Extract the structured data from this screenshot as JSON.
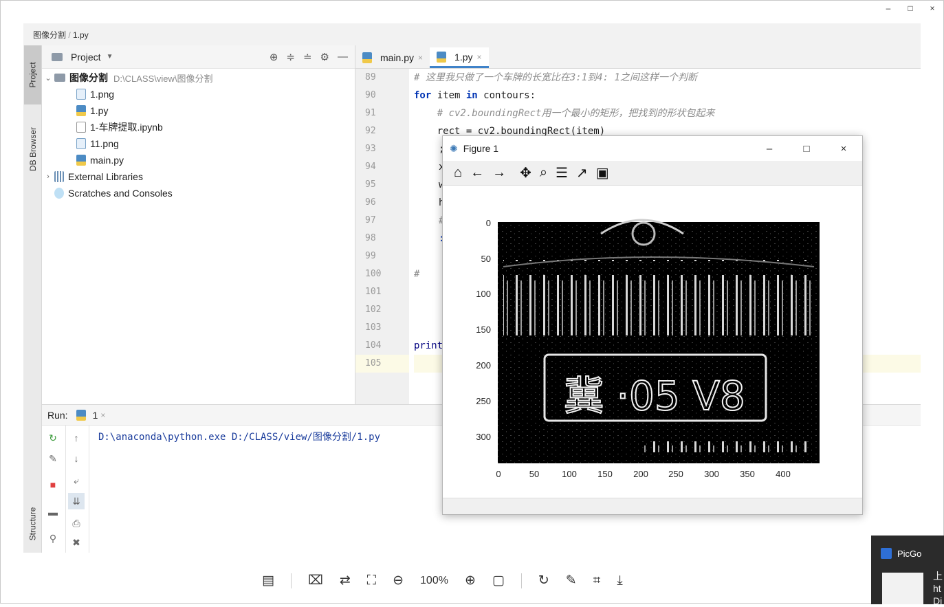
{
  "viewer": {
    "minimize": "–",
    "maximize": "□",
    "close": "×",
    "zoom_level": "100%",
    "tools": [
      "layout-icon",
      "ocr-icon",
      "translate-icon",
      "fit-icon",
      "zoom-out-icon",
      "zoom-in-icon",
      "actual-size-icon",
      "rotate-icon",
      "edit-icon",
      "crop-icon",
      "download-icon"
    ]
  },
  "breadcrumb": [
    "图像分割",
    "1.py"
  ],
  "side_tabs": {
    "project": "Project",
    "db_browser": "DB Browser",
    "structure": "Structure"
  },
  "project": {
    "title": "Project",
    "root_name": "图像分割",
    "root_path": "D:\\CLASS\\view\\图像分割",
    "files": [
      {
        "name": "1.png",
        "icon": "img"
      },
      {
        "name": "1.py",
        "icon": "py"
      },
      {
        "name": "1-车牌提取.ipynb",
        "icon": "nb"
      },
      {
        "name": "11.png",
        "icon": "img"
      },
      {
        "name": "main.py",
        "icon": "py"
      }
    ],
    "external": "External Libraries",
    "scratches": "Scratches and Consoles"
  },
  "editor": {
    "tabs": [
      "main.py",
      "1.py"
    ],
    "active_tab": "1.py",
    "line_numbers": [
      "89",
      "90",
      "91",
      "92",
      "93",
      "94",
      "95",
      "96",
      "97",
      "98",
      "99",
      "100",
      "101",
      "102",
      "103",
      "104",
      "105"
    ],
    "lines": {
      "l89": "# 这里我只做了一个车牌的长宽比在3:1到4: 1之间这样一个判断",
      "l90_kw1": "for",
      "l90_mid": " item ",
      "l90_kw2": "in",
      "l90_end": " contours:",
      "l91": "    # cv2.boundingRect用一个最小的矩形，把找到的形状包起来",
      "l92": "    rect = cv2.boundingRect(item)",
      "l93": ";",
      "l94": "x",
      "l95": "w",
      "l96": "h",
      "l97": "#",
      "l98": ":",
      "l100": "#",
      "l104": "print"
    }
  },
  "run": {
    "label": "Run:",
    "tab": "1",
    "output": "D:\\anaconda\\python.exe D:/CLASS/view/图像分割/1.py"
  },
  "figure": {
    "title": "Figure 1",
    "minimize": "–",
    "maximize": "□",
    "close": "×",
    "tools": [
      "home-icon",
      "back-icon",
      "forward-icon",
      "pan-icon",
      "zoom-icon",
      "configure-icon",
      "axes-icon",
      "save-icon"
    ],
    "plate_text": "冀 ·05 V8",
    "x_ticks": [
      "0",
      "50",
      "100",
      "150",
      "200",
      "250",
      "300",
      "350",
      "400"
    ],
    "y_ticks": [
      "0",
      "50",
      "100",
      "150",
      "200",
      "250",
      "300"
    ]
  },
  "picgo": {
    "label": "PicGo",
    "peek_1": "上",
    "peek_2": "ht",
    "peek_3": "Di"
  }
}
